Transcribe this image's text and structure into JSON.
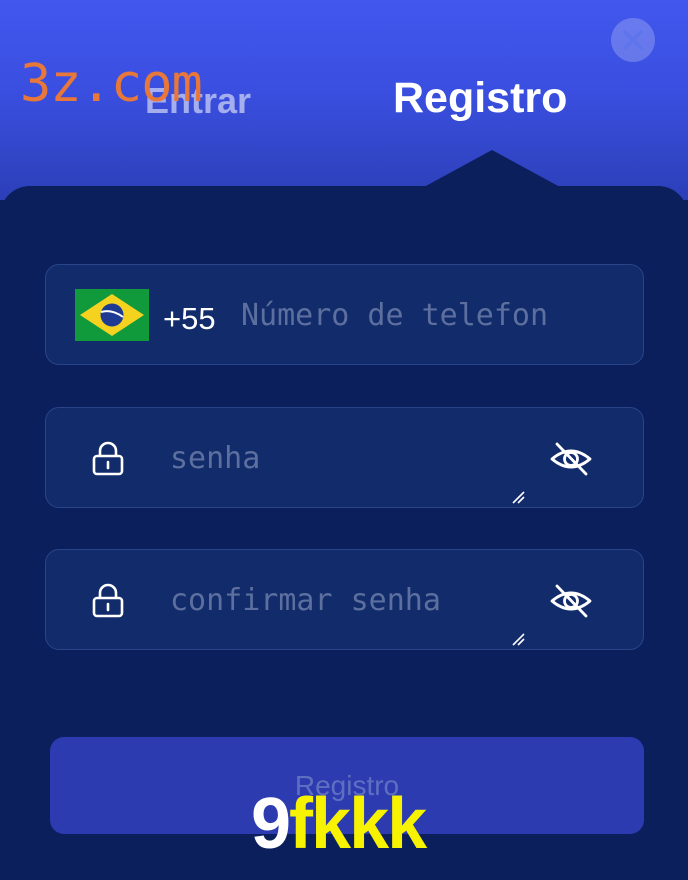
{
  "tabs": {
    "login_label": "Entrar",
    "register_label": "Registro",
    "active": "register"
  },
  "form": {
    "phone": {
      "country_code": "+55",
      "country": "Brazil",
      "flag_icon": "brazil-flag-icon",
      "placeholder": "Número de telefon",
      "value": ""
    },
    "password": {
      "placeholder": "senha",
      "value": "",
      "lock_icon": "lock-icon",
      "toggle_icon": "eye-off-icon"
    },
    "confirm_password": {
      "placeholder": "confirmar senha",
      "value": "",
      "lock_icon": "lock-icon",
      "toggle_icon": "eye-off-icon"
    },
    "submit_label": "Registro"
  },
  "close_icon": "close-icon",
  "watermarks": {
    "top": "3z.com",
    "bottom_prefix": "9",
    "bottom_suffix": "fkkk"
  },
  "colors": {
    "header_gradient_top": "#4157ee",
    "panel_background": "#0b1f5c",
    "field_background": "#122b6b",
    "submit_background": "#2c3cb0",
    "watermark_top": "#e8773a",
    "watermark_bottom": "#f7f200"
  }
}
